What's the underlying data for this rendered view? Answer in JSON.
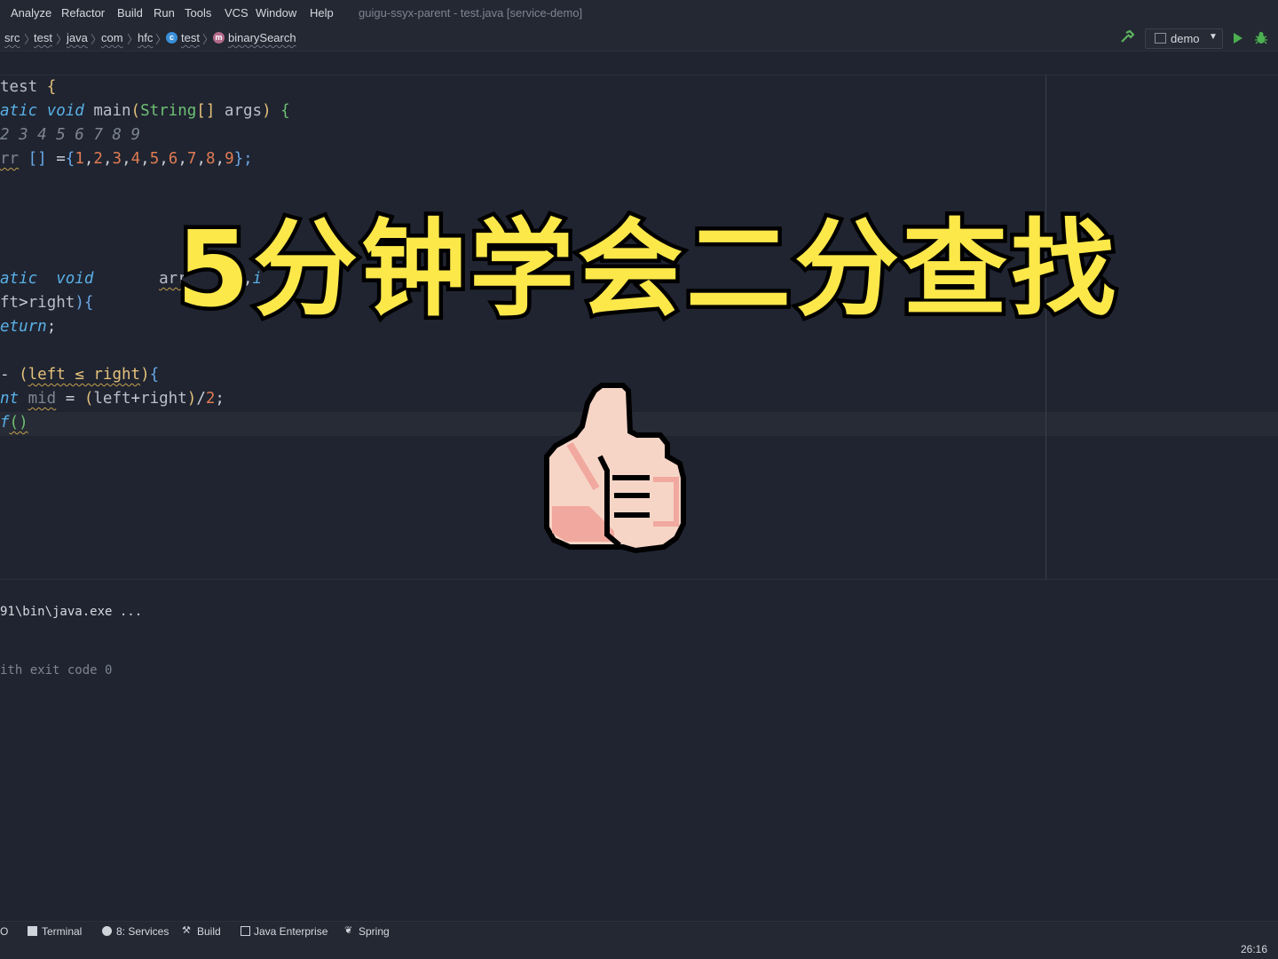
{
  "menubar": {
    "items": [
      "Analyze",
      "Refactor",
      "Build",
      "Run",
      "Tools",
      "VCS",
      "Window",
      "Help"
    ],
    "window_title": "guigu-ssyx-parent - test.java [service-demo]"
  },
  "breadcrumb": {
    "items": [
      "src",
      "test",
      "java",
      "com",
      "hfc",
      "test",
      "binarySearch"
    ]
  },
  "toolbar": {
    "run_config": "demo"
  },
  "editor": {
    "lines": [
      {
        "segs": [
          {
            "t": "test ",
            "c": "name"
          },
          {
            "t": "{",
            "c": "brace"
          }
        ]
      },
      {
        "segs": [
          {
            "t": "atic ",
            "c": "kw"
          },
          {
            "t": "void ",
            "c": "kw"
          },
          {
            "t": "main",
            "c": "name"
          },
          {
            "t": "(",
            "c": "brace"
          },
          {
            "t": "String",
            "c": "type"
          },
          {
            "t": "[] ",
            "c": "brace"
          },
          {
            "t": "args",
            "c": "name"
          },
          {
            "t": ") ",
            "c": "brace"
          },
          {
            "t": "{",
            "c": "type"
          }
        ]
      },
      {
        "segs": [
          {
            "t": "2 3 4 5 6 7 8 9",
            "c": "comment"
          }
        ]
      },
      {
        "segs": [
          {
            "t": "rr",
            "c": "dim warn"
          },
          {
            "t": " [] ",
            "c": "kw2"
          },
          {
            "t": "=",
            "c": "punct"
          },
          {
            "t": "{",
            "c": "kw2"
          },
          {
            "t": "1",
            "c": "num"
          },
          {
            "t": ",",
            "c": "punct"
          },
          {
            "t": "2",
            "c": "num"
          },
          {
            "t": ",",
            "c": "punct"
          },
          {
            "t": "3",
            "c": "num"
          },
          {
            "t": ",",
            "c": "punct"
          },
          {
            "t": "4",
            "c": "num"
          },
          {
            "t": ",",
            "c": "punct"
          },
          {
            "t": "5",
            "c": "num"
          },
          {
            "t": ",",
            "c": "punct"
          },
          {
            "t": "6",
            "c": "num"
          },
          {
            "t": ",",
            "c": "punct"
          },
          {
            "t": "7",
            "c": "num"
          },
          {
            "t": ",",
            "c": "punct"
          },
          {
            "t": "8",
            "c": "num"
          },
          {
            "t": ",",
            "c": "punct"
          },
          {
            "t": "9",
            "c": "num"
          },
          {
            "t": "};",
            "c": "kw2"
          }
        ]
      },
      {
        "segs": []
      },
      {
        "segs": []
      },
      {
        "segs": []
      },
      {
        "segs": []
      },
      {
        "segs": [
          {
            "t": "atic  void",
            "c": "kw"
          },
          {
            "t": "       ",
            "c": "punct"
          },
          {
            "t": "arr",
            "c": "name warn"
          },
          {
            "t": "      ,",
            "c": "punct"
          },
          {
            "t": "i",
            "c": "kw"
          }
        ]
      },
      {
        "segs": [
          {
            "t": "ft",
            "c": "name"
          },
          {
            "t": ">",
            "c": "punct"
          },
          {
            "t": "right",
            "c": "name"
          },
          {
            "t": "){",
            "c": "kw2"
          }
        ]
      },
      {
        "segs": [
          {
            "t": "eturn",
            "c": "kw"
          },
          {
            "t": ";",
            "c": "punct"
          }
        ]
      },
      {
        "segs": []
      },
      {
        "segs": [
          {
            "t": "- ",
            "c": "punct"
          },
          {
            "t": "(",
            "c": "brace"
          },
          {
            "t": "left ≤ right",
            "c": "brace warn"
          },
          {
            "t": ")",
            "c": "brace"
          },
          {
            "t": "{",
            "c": "kw2"
          }
        ]
      },
      {
        "segs": [
          {
            "t": "nt ",
            "c": "kw"
          },
          {
            "t": "mid",
            "c": "dim warn"
          },
          {
            "t": " = ",
            "c": "punct"
          },
          {
            "t": "(",
            "c": "brace"
          },
          {
            "t": "left",
            "c": "name"
          },
          {
            "t": "+",
            "c": "punct"
          },
          {
            "t": "right",
            "c": "name"
          },
          {
            "t": ")",
            "c": "brace"
          },
          {
            "t": "/",
            "c": "punct"
          },
          {
            "t": "2",
            "c": "num"
          },
          {
            "t": ";",
            "c": "punct"
          }
        ]
      },
      {
        "segs": [
          {
            "t": "f",
            "c": "kw"
          },
          {
            "t": "()",
            "c": "type warn"
          }
        ]
      }
    ]
  },
  "console": {
    "lines": [
      "91\\bin\\java.exe ...",
      "",
      "ith exit code 0"
    ]
  },
  "bottom_tools": {
    "items": [
      "Terminal",
      "8: Services",
      "Build",
      "Java Enterprise",
      "Spring"
    ],
    "cut_item": "O"
  },
  "status": {
    "caret_position": "26:16"
  },
  "overlay": {
    "title": "5分钟学会二分查找",
    "emoji": "thumbs-up"
  },
  "colors": {
    "background": "#1f2430",
    "overlay_text": "#fde84a",
    "overlay_outline": "#000000",
    "run_green": "#4caf50"
  }
}
